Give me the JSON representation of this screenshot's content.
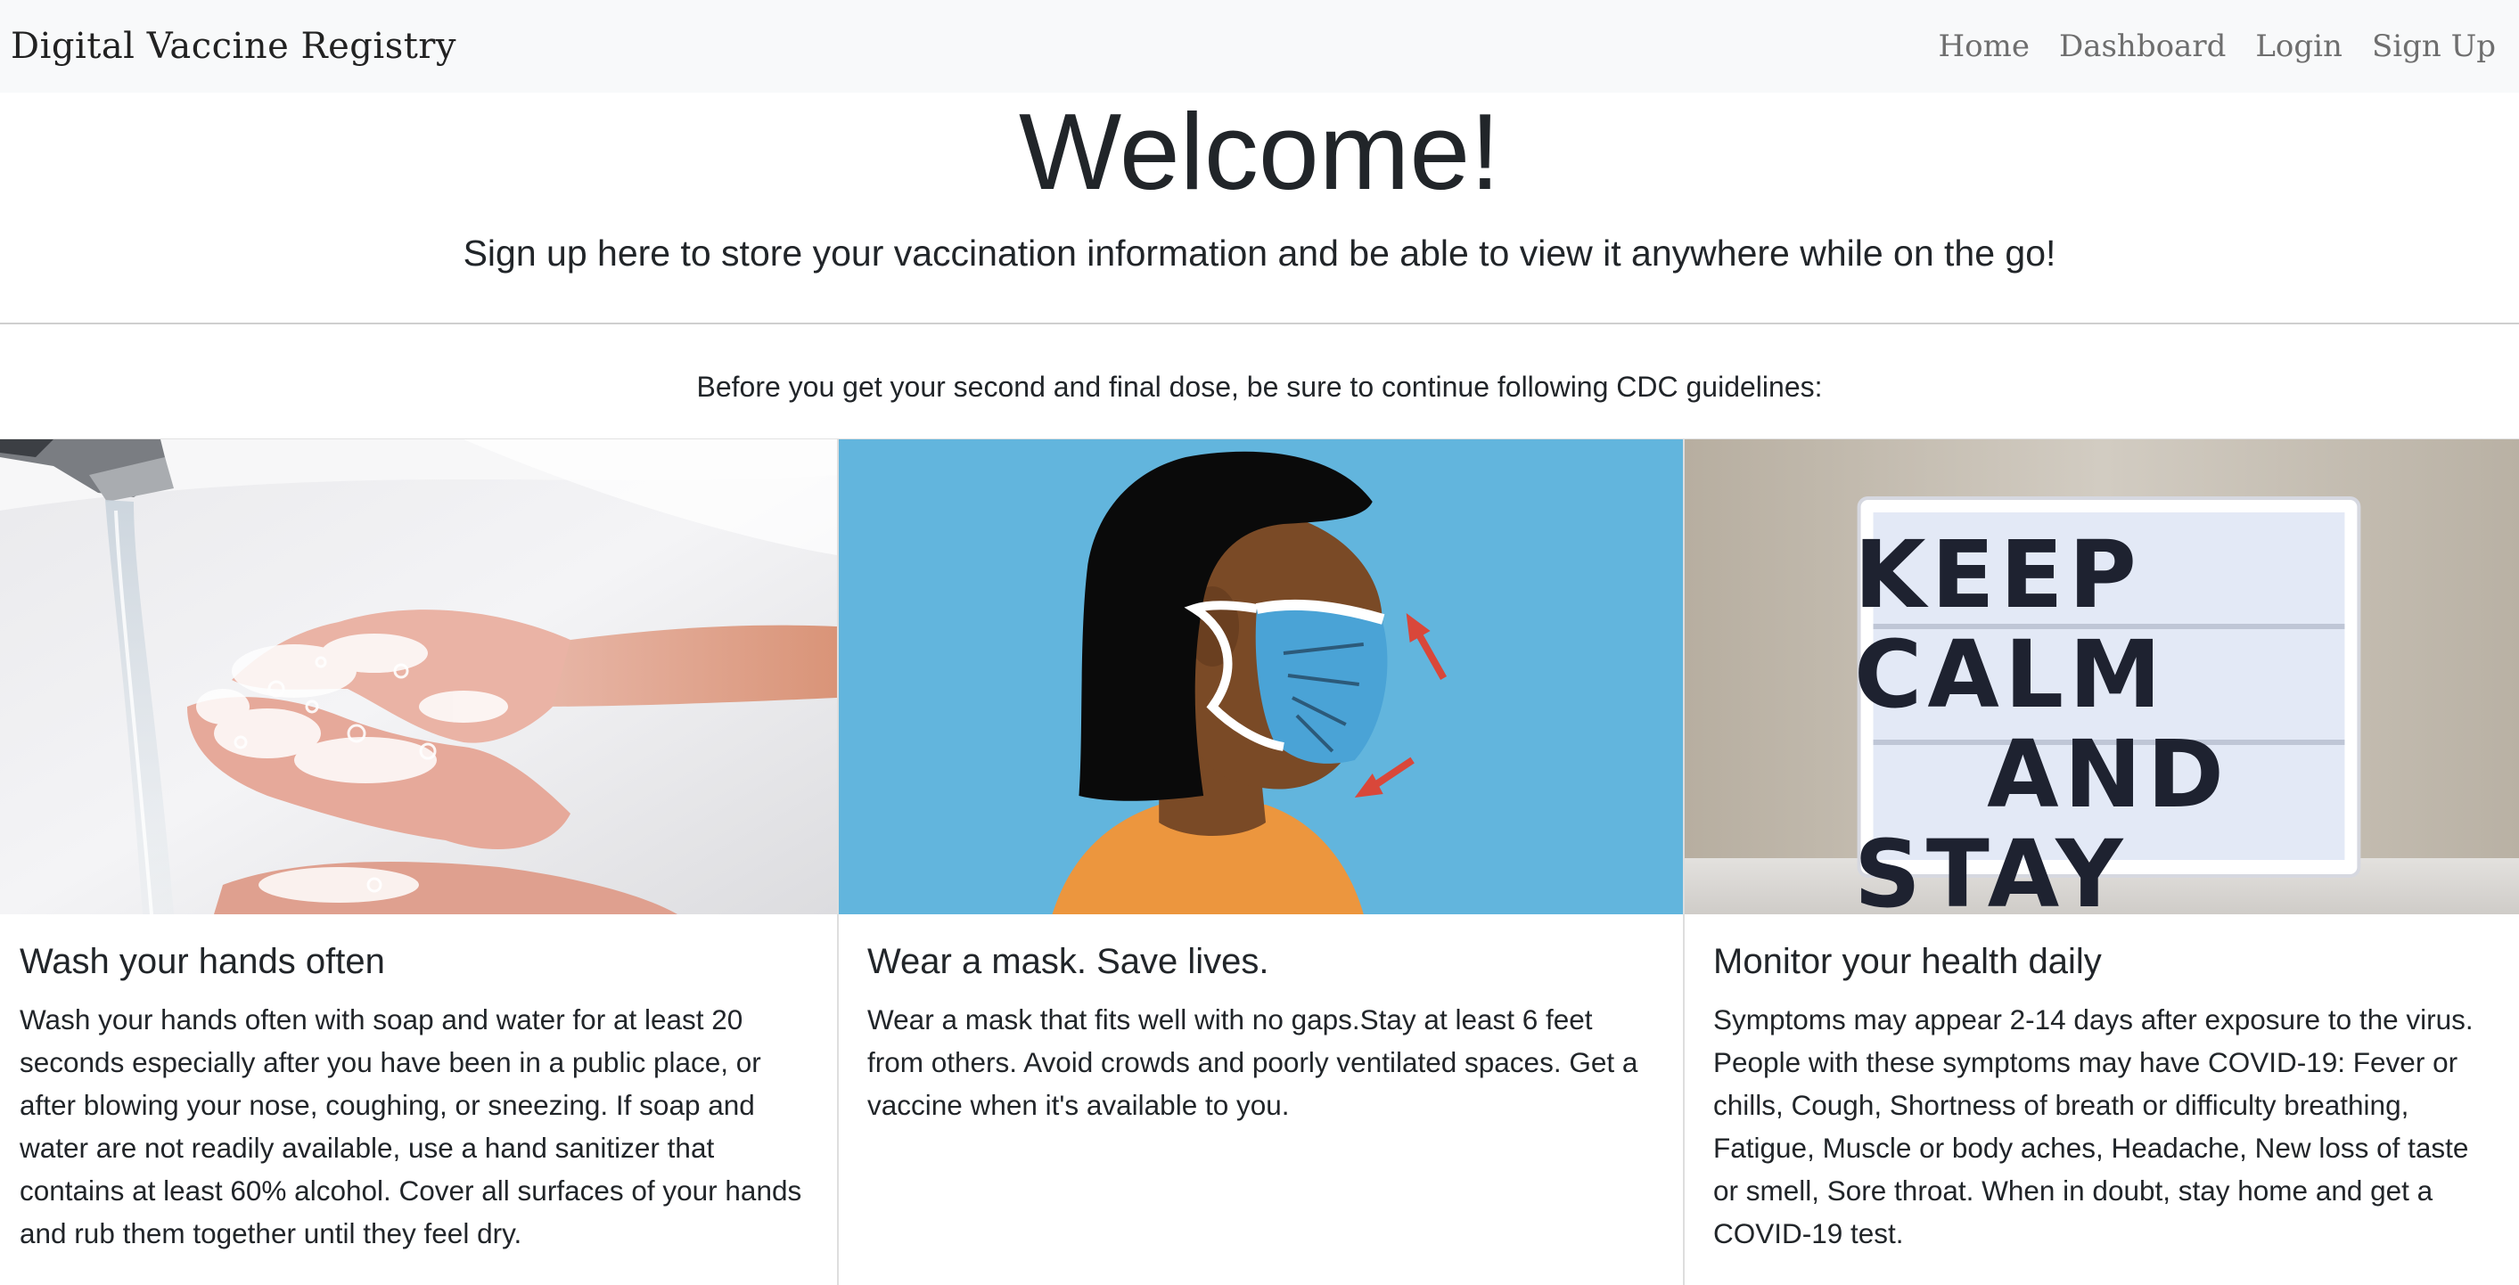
{
  "navbar": {
    "brand": "Digital Vaccine Registry",
    "links": [
      "Home",
      "Dashboard",
      "Login",
      "Sign Up"
    ]
  },
  "hero": {
    "title": "Welcome!",
    "subtitle": "Sign up here to store your vaccination information and be able to view it anywhere while on the go!"
  },
  "intro": "Before you get your second and final dose, be sure to continue following CDC guidelines:",
  "cards": [
    {
      "image": "handwashing-photo",
      "title": "Wash your hands often",
      "text": "Wash your hands often with soap and water for at least 20 seconds especially after you have been in a public place, or after blowing your nose, coughing, or sneezing. If soap and water are not readily available, use a hand sanitizer that contains at least 60% alcohol. Cover all surfaces of your hands and rub them together until they feel dry."
    },
    {
      "image": "mask-illustration",
      "title": "Wear a mask. Save lives.",
      "text": "Wear a mask that fits well with no gaps.Stay at least 6 feet from others. Avoid crowds and poorly ventilated spaces. Get a vaccine when it's available to you."
    },
    {
      "image": "lightbox-sign-photo",
      "sign_lines": [
        "KEEP CALM",
        "AND",
        "STAY HOME"
      ],
      "title": "Monitor your health daily",
      "text": "Symptoms may appear 2-14 days after exposure to the virus. People with these symptoms may have COVID-19: Fever or chills, Cough, Shortness of breath or difficulty breathing, Fatigue, Muscle or body aches, Headache, New loss of taste or smell, Sore throat. When in doubt, stay home and get a COVID-19 test."
    }
  ],
  "colors": {
    "navbar_bg": "#f8f9fa",
    "nav_link": "#6e6e6e",
    "mask_bg": "#62b5dd",
    "mask": "#4aa3d6",
    "shirt": "#ec963e",
    "arrow": "#d9473a"
  }
}
